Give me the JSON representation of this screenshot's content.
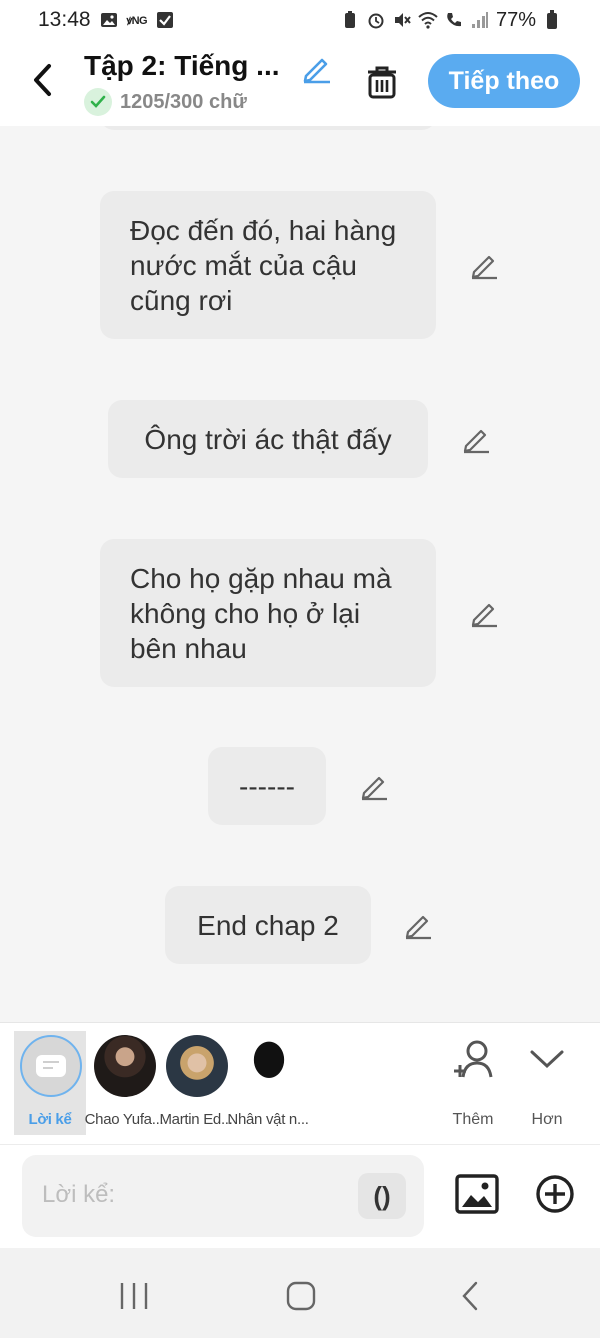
{
  "status_bar": {
    "time": "13:48",
    "carrier_badge": "ꝟNG",
    "battery_percent": "77%"
  },
  "header": {
    "title": "Tập 2: Tiếng ...",
    "word_count": "1205/300 chữ",
    "next_label": "Tiếp theo",
    "accent_color": "#5aabf0"
  },
  "messages": [
    {
      "text": "Đọc đến đó, hai hàng nước mắt của cậu cũng rơi"
    },
    {
      "text": "Ông trời ác thật đấy"
    },
    {
      "text": "Cho họ gặp nhau mà không cho họ ở lại bên nhau"
    },
    {
      "text": "------"
    },
    {
      "text": "End chap 2"
    }
  ],
  "characters": [
    {
      "name": "Lời kể",
      "selected": true
    },
    {
      "name": "Chao Yufa..."
    },
    {
      "name": "Martin Ed..."
    },
    {
      "name": "Nhân vật n..."
    }
  ],
  "actions": {
    "add_label": "Thêm",
    "more_label": "Hơn"
  },
  "input": {
    "placeholder": "Lời kể:",
    "paren_label": "()"
  }
}
